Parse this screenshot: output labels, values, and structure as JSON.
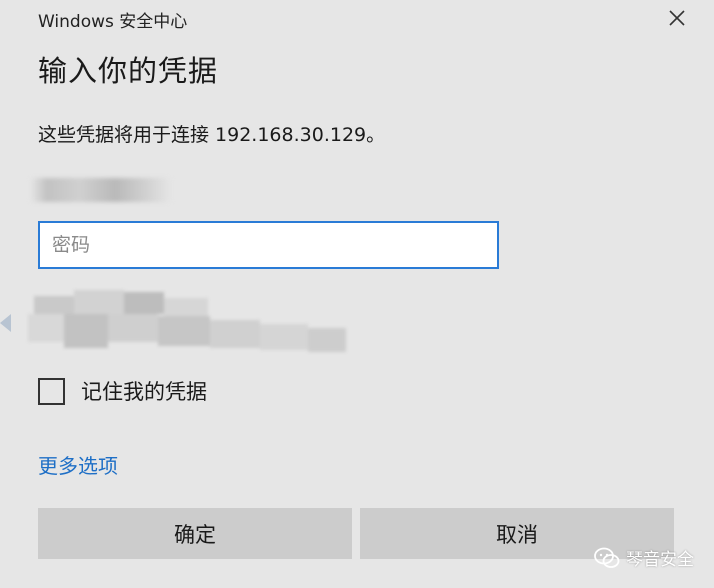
{
  "window": {
    "title": "Windows 安全中心",
    "close_icon": "close-icon"
  },
  "dialog": {
    "heading": "输入你的凭据",
    "description": "这些凭据将用于连接 192.168.30.129。"
  },
  "password_field": {
    "value": "",
    "placeholder": "密码"
  },
  "remember": {
    "label": "记住我的凭据",
    "checked": false
  },
  "links": {
    "more_options": "更多选项"
  },
  "buttons": {
    "ok": "确定",
    "cancel": "取消"
  },
  "watermark": {
    "text": "琴音安全",
    "icon": "wechat-icon"
  },
  "colors": {
    "background": "#e6e6e6",
    "accent": "#2a7bd6",
    "link": "#1e6fc6",
    "button": "#cccccc"
  }
}
